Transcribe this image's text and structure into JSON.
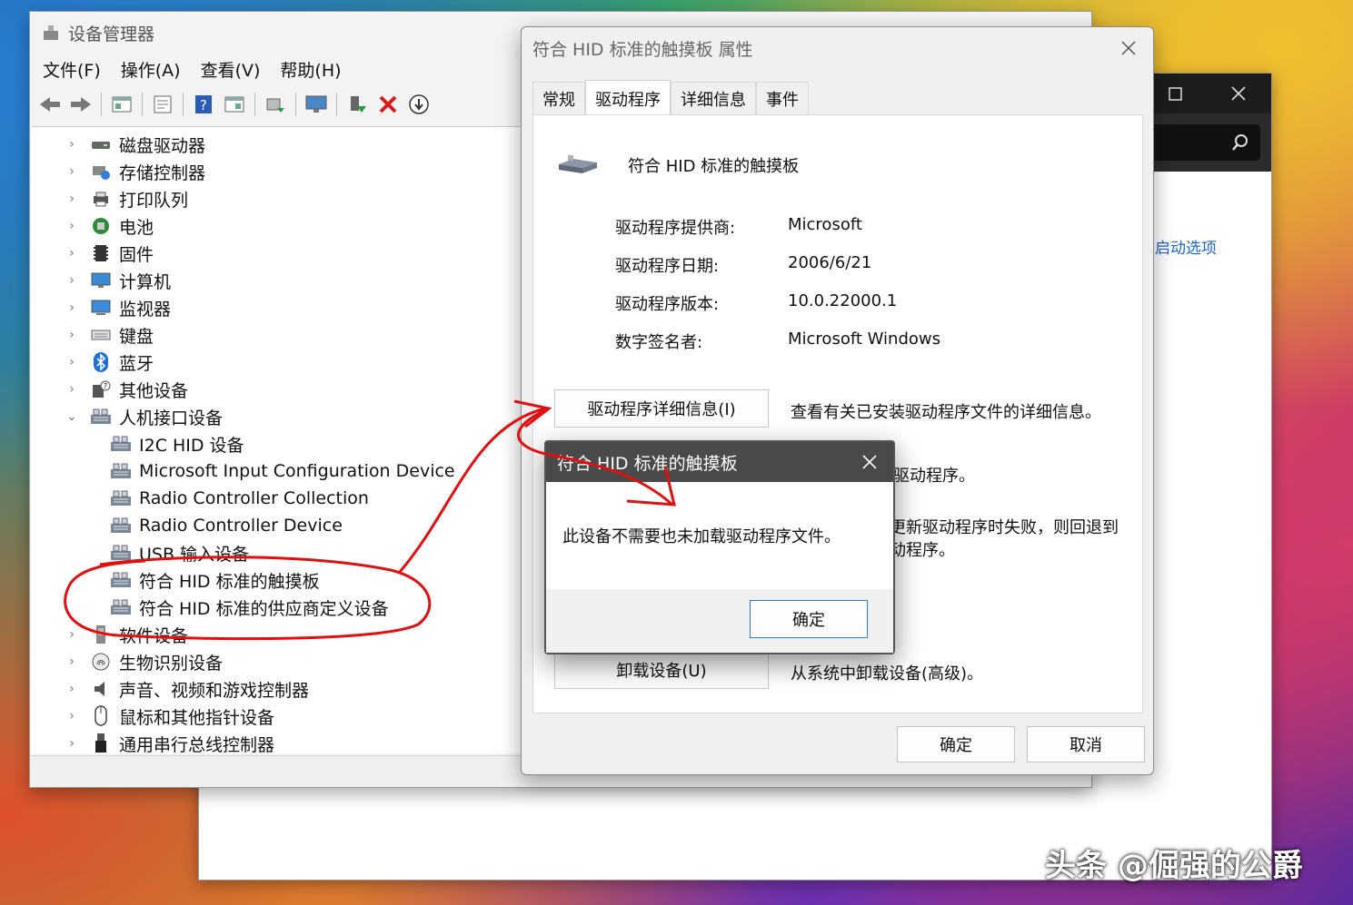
{
  "device_manager": {
    "title": "设备管理器",
    "menu": [
      "文件(F)",
      "操作(A)",
      "查看(V)",
      "帮助(H)"
    ],
    "tree": [
      {
        "label": "磁盘驱动器",
        "icon": "disk-drive-icon"
      },
      {
        "label": "存储控制器",
        "icon": "storage-controller-icon"
      },
      {
        "label": "打印队列",
        "icon": "printer-icon"
      },
      {
        "label": "电池",
        "icon": "battery-icon"
      },
      {
        "label": "固件",
        "icon": "firmware-icon"
      },
      {
        "label": "计算机",
        "icon": "computer-icon"
      },
      {
        "label": "监视器",
        "icon": "monitor-icon"
      },
      {
        "label": "键盘",
        "icon": "keyboard-icon"
      },
      {
        "label": "蓝牙",
        "icon": "bluetooth-icon"
      },
      {
        "label": "其他设备",
        "icon": "unknown-device-icon"
      },
      {
        "label": "人机接口设备",
        "icon": "hid-icon"
      },
      {
        "label": "I2C HID 设备",
        "icon": "hid-icon"
      },
      {
        "label": "Microsoft Input Configuration Device",
        "icon": "hid-icon"
      },
      {
        "label": "Radio Controller Collection",
        "icon": "hid-icon"
      },
      {
        "label": "Radio Controller Device",
        "icon": "hid-icon"
      },
      {
        "label": "USB 输入设备",
        "icon": "hid-icon"
      },
      {
        "label": "符合 HID 标准的触摸板",
        "icon": "hid-icon"
      },
      {
        "label": "符合 HID 标准的供应商定义设备",
        "icon": "hid-icon"
      },
      {
        "label": "软件设备",
        "icon": "software-device-icon"
      },
      {
        "label": "生物识别设备",
        "icon": "fingerprint-icon"
      },
      {
        "label": "声音、视频和游戏控制器",
        "icon": "speaker-icon"
      },
      {
        "label": "鼠标和其他指针设备",
        "icon": "mouse-icon"
      },
      {
        "label": "通用串行总线控制器",
        "icon": "usb-icon"
      }
    ]
  },
  "background_window": {
    "link": "启动选项"
  },
  "properties": {
    "title": "符合 HID 标准的触摸板 属性",
    "tabs": [
      "常规",
      "驱动程序",
      "详细信息",
      "事件"
    ],
    "active_tab": "驱动程序",
    "device_name": "符合 HID 标准的触摸板",
    "info": [
      {
        "key": "驱动程序提供商:",
        "value": "Microsoft"
      },
      {
        "key": "驱动程序日期:",
        "value": "2006/6/21"
      },
      {
        "key": "驱动程序版本:",
        "value": "10.0.22000.1"
      },
      {
        "key": "数字签名者:",
        "value": "Microsoft Windows"
      }
    ],
    "details_button": "驱动程序详细信息(I)",
    "details_desc": "查看有关已安装驱动程序文件的详细信息。",
    "partial_desc_1": "驱动程序。",
    "partial_desc_2a": "更新驱动程序时失败，则回退到",
    "partial_desc_2b": "动程序。",
    "uninstall_button": "卸载设备(U)",
    "uninstall_desc": "从系统中卸载设备(高级)。",
    "ok": "确定",
    "cancel": "取消"
  },
  "message_box": {
    "title": "符合 HID 标准的触摸板",
    "message": "此设备不需要也未加载驱动程序文件。",
    "ok": "确定"
  },
  "watermark": "头条 @倔强的公爵",
  "colors": {
    "annotation_red": "#e01010",
    "link_blue": "#1f66c1"
  }
}
